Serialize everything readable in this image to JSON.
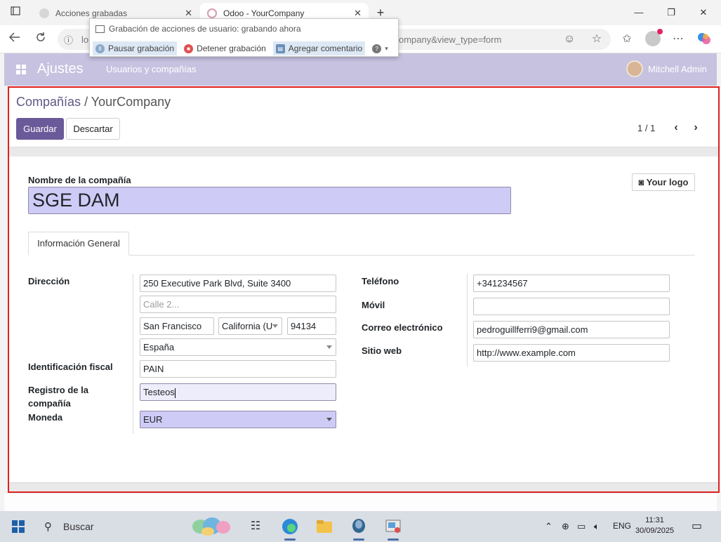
{
  "browser": {
    "tabs": [
      {
        "title": "Acciones grabadas",
        "close": "✕"
      },
      {
        "title": "Odoo - YourCompany",
        "close": "✕"
      }
    ],
    "new_tab": "+",
    "window_controls": {
      "minimize": "—",
      "restore": "❐",
      "close": "✕"
    },
    "address_left": "lo",
    "address_tail": "ompany&view_type=form",
    "nav_icons": {
      "back": "back-arrow-icon",
      "reload": "reload-icon",
      "info": "info-icon"
    }
  },
  "recorder": {
    "title": "Grabación de acciones de usuario: grabando ahora",
    "pause": "Pausar grabación",
    "stop": "Detener grabación",
    "comment": "Agregar comentario",
    "help": "?"
  },
  "odoo_nav": {
    "app_name": "Ajustes",
    "menu_item": "Usuarios y compañías",
    "user_name": "Mitchell Admin"
  },
  "breadcrumb": {
    "parent": "Compañías",
    "separator": " / ",
    "current": "YourCompany"
  },
  "actions": {
    "save": "Guardar",
    "discard": "Descartar"
  },
  "pager": {
    "value": "1 / 1",
    "prev": "‹",
    "next": "›"
  },
  "form": {
    "name_label": "Nombre de la compañía",
    "name_value": "SGE DAM",
    "logo_button": "Your logo",
    "tab_general": "Información General",
    "address_label": "Dirección",
    "street": "250 Executive Park Blvd, Suite 3400",
    "street2_placeholder": "Calle 2...",
    "city": "San Francisco",
    "state": "California (U",
    "zip": "94134",
    "country": "España",
    "vat_label": "Identificación fiscal",
    "vat": "PAIN",
    "registry_label_line1": "Registro de la",
    "registry_label_line2": "compañía",
    "registry": "Testeos",
    "currency_label": "Moneda",
    "currency": "EUR",
    "phone_label": "Teléfono",
    "phone": "+341234567",
    "mobile_label": "Móvil",
    "mobile": "",
    "email_label": "Correo electrónico",
    "email": "pedroguillferri9@gmail.com",
    "website_label": "Sitio web",
    "website": "http://www.example.com"
  },
  "taskbar": {
    "search_placeholder": "Buscar",
    "language": "ENG",
    "time": "11:31",
    "date": "30/09/2025"
  },
  "colors": {
    "nav_bg": "#c6c2e0",
    "primary": "#6a5a99",
    "field_highlight": "#cfcbf7",
    "frame_border": "#e02020"
  }
}
